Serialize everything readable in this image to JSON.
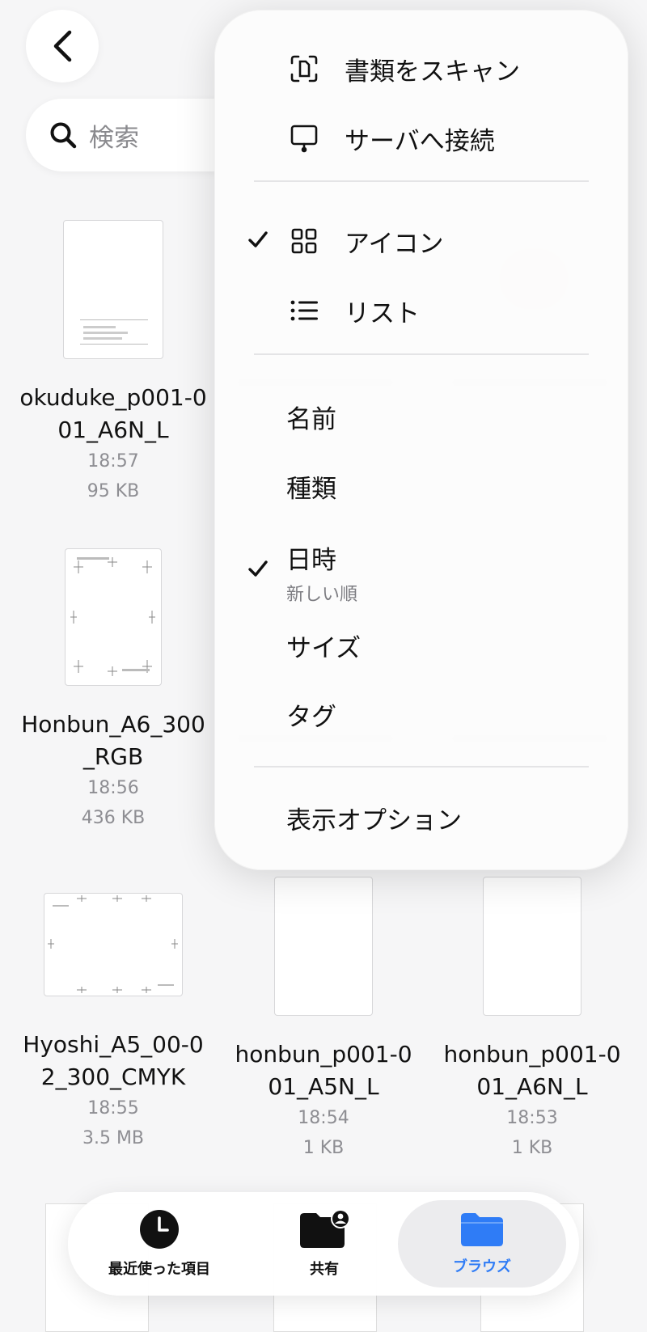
{
  "header": {
    "back_icon": "chevron-left-icon"
  },
  "search": {
    "placeholder": "検索",
    "icon": "search-icon"
  },
  "files": [
    {
      "name": "okuduke_p001-001_A6N_L",
      "time": "18:57",
      "size": "95 KB"
    },
    {
      "name": "Honbun_A6_300_RGB",
      "time": "18:56",
      "size": "436 KB"
    },
    {
      "name": "Hyoshi_A5_00-02_300_CMYK",
      "time": "18:55",
      "size": "3.5 MB"
    },
    {
      "name": "honbun_p001-001_A5N_L",
      "time": "18:54",
      "size": "1 KB"
    },
    {
      "name": "honbun_p001-001_A6N_L",
      "time": "18:53",
      "size": "1 KB"
    }
  ],
  "menu": {
    "scan": "書類をスキャン",
    "connect_server": "サーバへ接続",
    "view_icon": "アイコン",
    "view_list": "リスト",
    "sort_name": "名前",
    "sort_kind": "種類",
    "sort_date": "日時",
    "sort_date_sub": "新しい順",
    "sort_size": "サイズ",
    "sort_tags": "タグ",
    "view_options": "表示オプション",
    "checked_view": "アイコン",
    "checked_sort": "日時"
  },
  "tabbar": {
    "recents": "最近使った項目",
    "shared": "共有",
    "browse": "ブラウズ",
    "active_color": "#2f7cf6"
  }
}
